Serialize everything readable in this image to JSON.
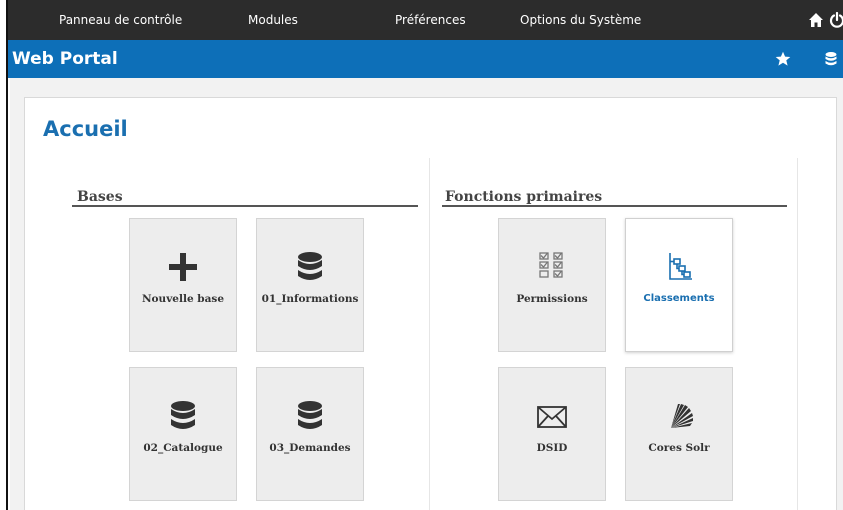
{
  "topbar": {
    "menu": [
      {
        "label": "Panneau de contrôle"
      },
      {
        "label": "Modules"
      },
      {
        "label": "Préférences"
      },
      {
        "label": "Options du Système"
      }
    ]
  },
  "titlebar": {
    "title": "Web Portal"
  },
  "page": {
    "title": "Accueil"
  },
  "bases": {
    "title": "Bases",
    "tiles": [
      {
        "label": "Nouvelle base",
        "icon": "plus-icon"
      },
      {
        "label": "01_Informations",
        "icon": "database-icon"
      },
      {
        "label": "02_Catalogue",
        "icon": "database-icon"
      },
      {
        "label": "03_Demandes",
        "icon": "database-icon"
      }
    ]
  },
  "fonctions": {
    "title": "Fonctions primaires",
    "tiles": [
      {
        "label": "Permissions",
        "icon": "checkbox-list-icon"
      },
      {
        "label": "Classements",
        "icon": "hierarchy-icon",
        "active": true
      },
      {
        "label": "DSID",
        "icon": "envelope-icon"
      },
      {
        "label": "Cores Solr",
        "icon": "solr-icon"
      }
    ]
  },
  "colors": {
    "topbar_bg": "#2c2c2c",
    "titlebar_bg": "#0d6fb8",
    "accent": "#1a6fb0",
    "tile_bg": "#ededed"
  }
}
